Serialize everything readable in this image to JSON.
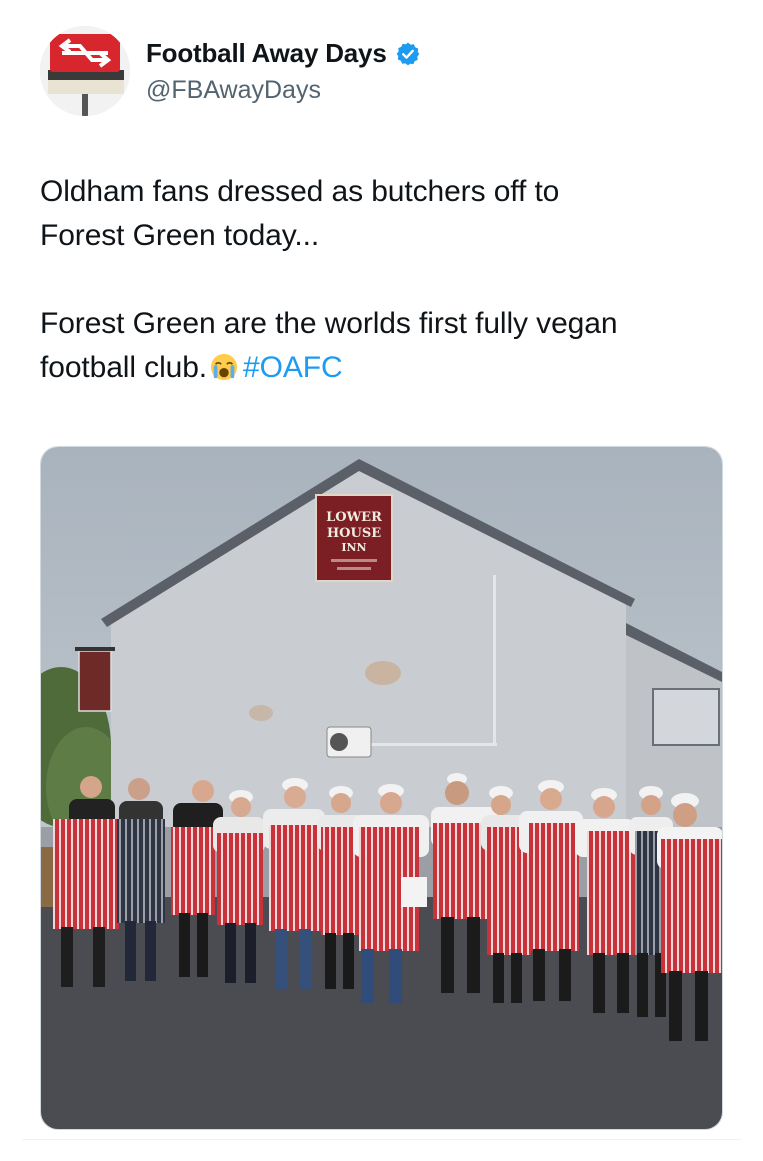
{
  "author": {
    "display_name": "Football Away Days",
    "handle": "@FBAwayDays",
    "verified": true,
    "avatar_icon": "national-rail-logo-icon",
    "verified_icon": "verified-badge-icon",
    "verified_color": "#1d9bf0"
  },
  "tweet": {
    "line1": "Oldham fans dressed as butchers off to",
    "line2": "Forest Green today...",
    "line3": "Forest Green are the worlds first fully vegan",
    "line4_prefix": "football club.",
    "emoji_icon": "loudly-crying-face-icon",
    "hashtag": "#OAFC",
    "hashtag_color": "#1d9bf0"
  },
  "media": {
    "pub_sign": {
      "line1": "LOWER",
      "line2": "HOUSE",
      "line3": "INN"
    },
    "colors": {
      "sky": "#b9c2cb",
      "wall": "#c9ccd1",
      "roof": "#5b6068",
      "ground": "#4a4c51",
      "apron_red": "#c8323a",
      "sign": "#7b1f24"
    }
  }
}
